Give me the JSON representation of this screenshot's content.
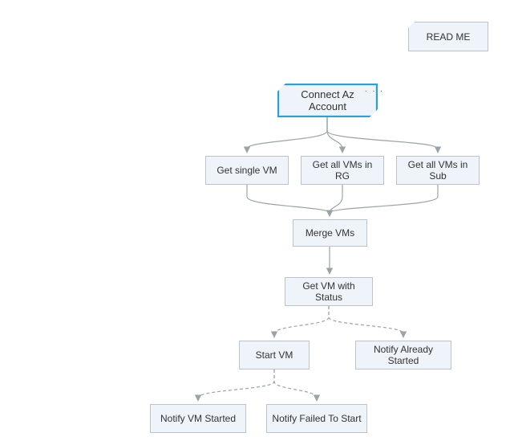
{
  "nodes": {
    "readme": "READ ME",
    "connect": "Connect Az Account",
    "dots": ". . .",
    "get_single": "Get single VM",
    "get_rg": "Get all VMs in RG",
    "get_sub": "Get all VMs in Sub",
    "merge": "Merge VMs",
    "status": "Get VM with Status",
    "start": "Start VM",
    "already": "Notify Already Started",
    "vm_started": "Notify VM Started",
    "failed": "Notify Failed To Start"
  },
  "chart_data": {
    "type": "diagram",
    "title": "",
    "nodes": [
      {
        "id": "readme",
        "label": "READ ME",
        "kind": "note"
      },
      {
        "id": "connect",
        "label": "Connect Az Account",
        "kind": "start",
        "selected": true
      },
      {
        "id": "get_single",
        "label": "Get single VM",
        "kind": "process"
      },
      {
        "id": "get_rg",
        "label": "Get all VMs in RG",
        "kind": "process"
      },
      {
        "id": "get_sub",
        "label": "Get all VMs in Sub",
        "kind": "process"
      },
      {
        "id": "merge",
        "label": "Merge VMs",
        "kind": "process"
      },
      {
        "id": "status",
        "label": "Get VM with Status",
        "kind": "process"
      },
      {
        "id": "start",
        "label": "Start VM",
        "kind": "process"
      },
      {
        "id": "already",
        "label": "Notify Already Started",
        "kind": "process"
      },
      {
        "id": "vm_started",
        "label": "Notify VM Started",
        "kind": "process"
      },
      {
        "id": "failed",
        "label": "Notify Failed To Start",
        "kind": "process"
      }
    ],
    "edges": [
      {
        "from": "connect",
        "to": "get_single",
        "style": "solid"
      },
      {
        "from": "connect",
        "to": "get_rg",
        "style": "solid"
      },
      {
        "from": "connect",
        "to": "get_sub",
        "style": "solid"
      },
      {
        "from": "get_single",
        "to": "merge",
        "style": "solid"
      },
      {
        "from": "get_rg",
        "to": "merge",
        "style": "solid"
      },
      {
        "from": "get_sub",
        "to": "merge",
        "style": "solid"
      },
      {
        "from": "merge",
        "to": "status",
        "style": "solid"
      },
      {
        "from": "status",
        "to": "start",
        "style": "dashed"
      },
      {
        "from": "status",
        "to": "already",
        "style": "dashed"
      },
      {
        "from": "start",
        "to": "vm_started",
        "style": "dashed"
      },
      {
        "from": "start",
        "to": "failed",
        "style": "dashed"
      }
    ]
  }
}
